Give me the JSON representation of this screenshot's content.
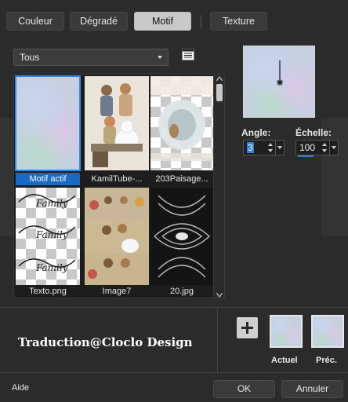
{
  "tabs": [
    {
      "label": "Couleur",
      "active": false
    },
    {
      "label": "Dégradé",
      "active": false
    },
    {
      "label": "Motif",
      "active": true
    },
    {
      "label": "Texture",
      "active": false
    }
  ],
  "category_dropdown": {
    "value": "Tous"
  },
  "gallery": {
    "items": [
      {
        "caption": "Motif actif",
        "selected": true
      },
      {
        "caption": "KamilTube-...",
        "selected": false
      },
      {
        "caption": "203Paisage...",
        "selected": false
      },
      {
        "caption": "Texto.png",
        "selected": false
      },
      {
        "caption": "Image7",
        "selected": false
      },
      {
        "caption": "20.jpg",
        "selected": false
      }
    ],
    "thumb_text": "Family"
  },
  "angle": {
    "label": "Angle:",
    "value": "3"
  },
  "scale": {
    "label": "Échelle:",
    "value": "100"
  },
  "credit": "Traduction@Cloclo Design",
  "swatches": {
    "current_label": "Actuel",
    "previous_label": "Préc."
  },
  "footer": {
    "help": "Aide",
    "ok": "OK",
    "cancel": "Annuler"
  },
  "colors": {
    "accent": "#1669c4",
    "background": "#2b2b2b",
    "selection_outline": "#2f8be6"
  }
}
